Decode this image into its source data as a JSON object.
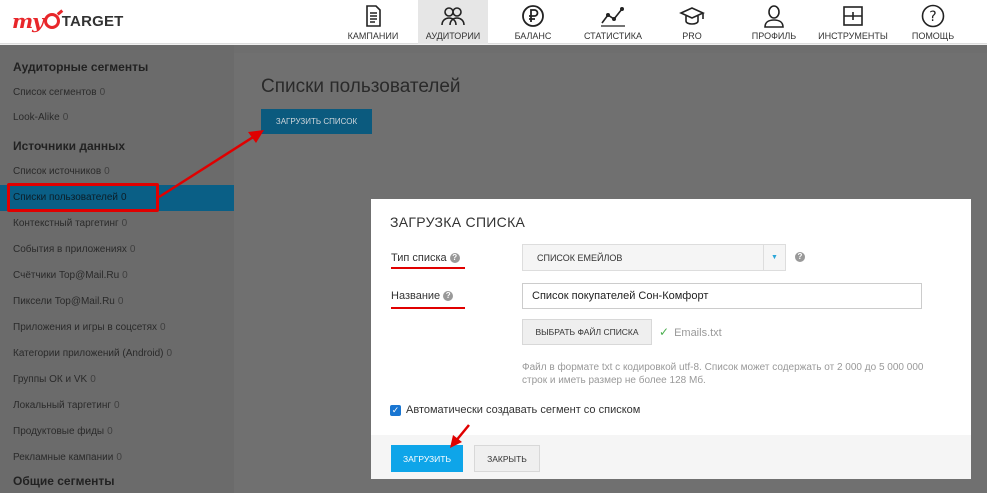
{
  "logo": {
    "prefix": "my",
    "name": "TARGET"
  },
  "nav": [
    {
      "label": "КАМПАНИИ",
      "icon": "document-icon",
      "active": false
    },
    {
      "label": "АУДИТОРИИ",
      "icon": "users-icon",
      "active": true
    },
    {
      "label": "БАЛАНС",
      "icon": "ruble-icon",
      "active": false
    },
    {
      "label": "СТАТИСТИКА",
      "icon": "chart-icon",
      "active": false
    },
    {
      "label": "PRO",
      "icon": "graduation-cap-icon",
      "active": false
    },
    {
      "label": "ПРОФИЛЬ",
      "icon": "user-icon",
      "active": false
    },
    {
      "label": "ИНСТРУМЕНТЫ",
      "icon": "tools-icon",
      "active": false
    },
    {
      "label": "ПОМОЩЬ",
      "icon": "help-icon",
      "active": false
    }
  ],
  "sidebar": {
    "section1": "Аудиторные сегменты",
    "section2": "Источники данных",
    "section3": "Общие сегменты",
    "items1": [
      {
        "label": "Список сегментов",
        "count": "0"
      },
      {
        "label": "Look-Alike",
        "count": "0"
      }
    ],
    "items2": [
      {
        "label": "Список источников",
        "count": "0"
      },
      {
        "label": "Списки пользователей",
        "count": "0"
      },
      {
        "label": "Контекстный таргетинг",
        "count": "0"
      },
      {
        "label": "События в приложениях",
        "count": "0"
      },
      {
        "label": "Счётчики Top@Mail.Ru",
        "count": "0"
      },
      {
        "label": "Пиксели Top@Mail.Ru",
        "count": "0"
      },
      {
        "label": "Приложения и игры в соцсетях",
        "count": "0"
      },
      {
        "label": "Категории приложений (Android)",
        "count": "0"
      },
      {
        "label": "Группы ОК и VK",
        "count": "0"
      },
      {
        "label": "Локальный таргетинг",
        "count": "0"
      },
      {
        "label": "Продуктовые фиды",
        "count": "0"
      },
      {
        "label": "Рекламные кампании",
        "count": "0"
      }
    ]
  },
  "main": {
    "title": "Списки пользователей",
    "upload_button": "ЗАГРУЗИТЬ СПИСОК"
  },
  "modal": {
    "title": "ЗАГРУЗКА СПИСКА",
    "type_label": "Тип списка",
    "type_value": "СПИСОК ЕМЕЙЛОВ",
    "name_label": "Название",
    "name_value": "Список покупателей Сон-Комфорт",
    "file_button": "ВЫБРАТЬ ФАЙЛ СПИСКА",
    "file_name": "Emails.txt",
    "hint": "Файл в формате txt с кодировкой utf-8. Список может содержать от 2 000 до 5 000 000 строк и иметь размер не более 128 Мб.",
    "auto_segment_label": "Автоматически создавать сегмент со списком",
    "auto_segment_checked": true,
    "submit_button": "ЗАГРУЗИТЬ",
    "close_button": "ЗАКРЫТЬ"
  },
  "colors": {
    "accent": "#0ea5e9",
    "annotation": "#e00000",
    "brand": "#e8262a"
  }
}
